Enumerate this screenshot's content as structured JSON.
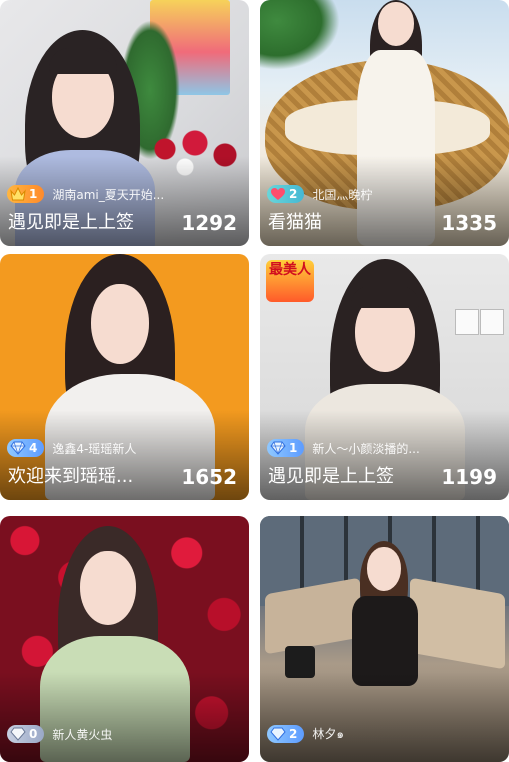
{
  "cards": [
    {
      "badge": {
        "type": "crown",
        "level": "1",
        "icon": "crown-icon"
      },
      "nickname": "湖南ami_夏天开始...",
      "title": "遇见即是上上签",
      "viewers": "1292"
    },
    {
      "badge": {
        "type": "heart",
        "level": "2",
        "icon": "heart-icon"
      },
      "nickname": "北国灬晚柠",
      "title": "看猫猫",
      "viewers": "1335"
    },
    {
      "badge": {
        "type": "diamond",
        "level": "4",
        "icon": "diamond-icon"
      },
      "nickname": "逸鑫4-瑶瑶新人",
      "title": "欢迎来到瑶瑶...",
      "viewers": "1652"
    },
    {
      "badge": {
        "type": "diamond",
        "level": "1",
        "icon": "diamond-icon"
      },
      "nickname": "新人～小颜淡播的...",
      "title": "遇见即是上上签",
      "viewers": "1199",
      "sticker": "最美人"
    },
    {
      "badge": {
        "type": "diamond",
        "level": "0",
        "icon": "diamond-icon"
      },
      "nickname": "新人黄火虫",
      "title": "",
      "viewers": ""
    },
    {
      "badge": {
        "type": "diamond",
        "level": "2",
        "icon": "diamond-icon"
      },
      "nickname": "林夕๑",
      "title": "",
      "viewers": ""
    }
  ],
  "colors": {
    "crown_badge": "#ff9d33",
    "heart_badge": "#4fc3d8",
    "diamond_badge": "#6aa8ff",
    "card3_bg": "#f39a1f"
  }
}
